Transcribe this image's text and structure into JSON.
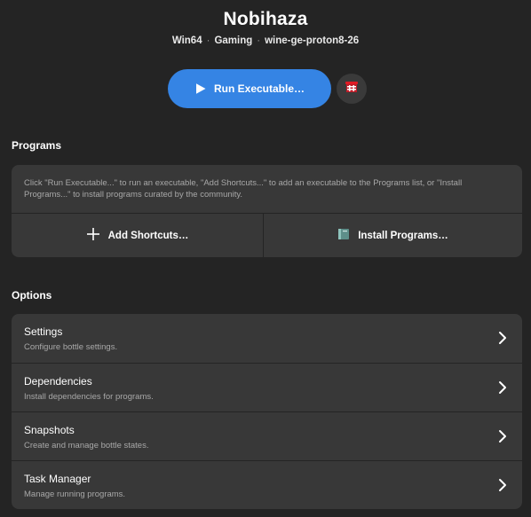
{
  "header": {
    "title": "Nobihaza",
    "tags": [
      "Win64",
      "Gaming",
      "wine-ge-proton8-26"
    ],
    "separator": "·"
  },
  "actions": {
    "run_label": "Run Executable…",
    "accent_color": "#3584e4"
  },
  "programs": {
    "section_title": "Programs",
    "description": "Click \"Run Executable...\" to run an executable, \"Add Shortcuts...\" to add an executable to the Programs list, or \"Install Programs...\" to install programs curated by the community.",
    "add_label": "Add Shortcuts…",
    "install_label": "Install Programs…"
  },
  "options": {
    "section_title": "Options",
    "items": [
      {
        "label": "Settings",
        "subtitle": "Configure bottle settings."
      },
      {
        "label": "Dependencies",
        "subtitle": "Install dependencies for programs."
      },
      {
        "label": "Snapshots",
        "subtitle": "Create and manage bottle states."
      },
      {
        "label": "Task Manager",
        "subtitle": "Manage running programs."
      }
    ]
  },
  "icons": {
    "run": "play-icon",
    "bottle": "bottle-icon",
    "add": "plus-icon",
    "install": "book-icon",
    "row": "chevron-right-icon"
  }
}
